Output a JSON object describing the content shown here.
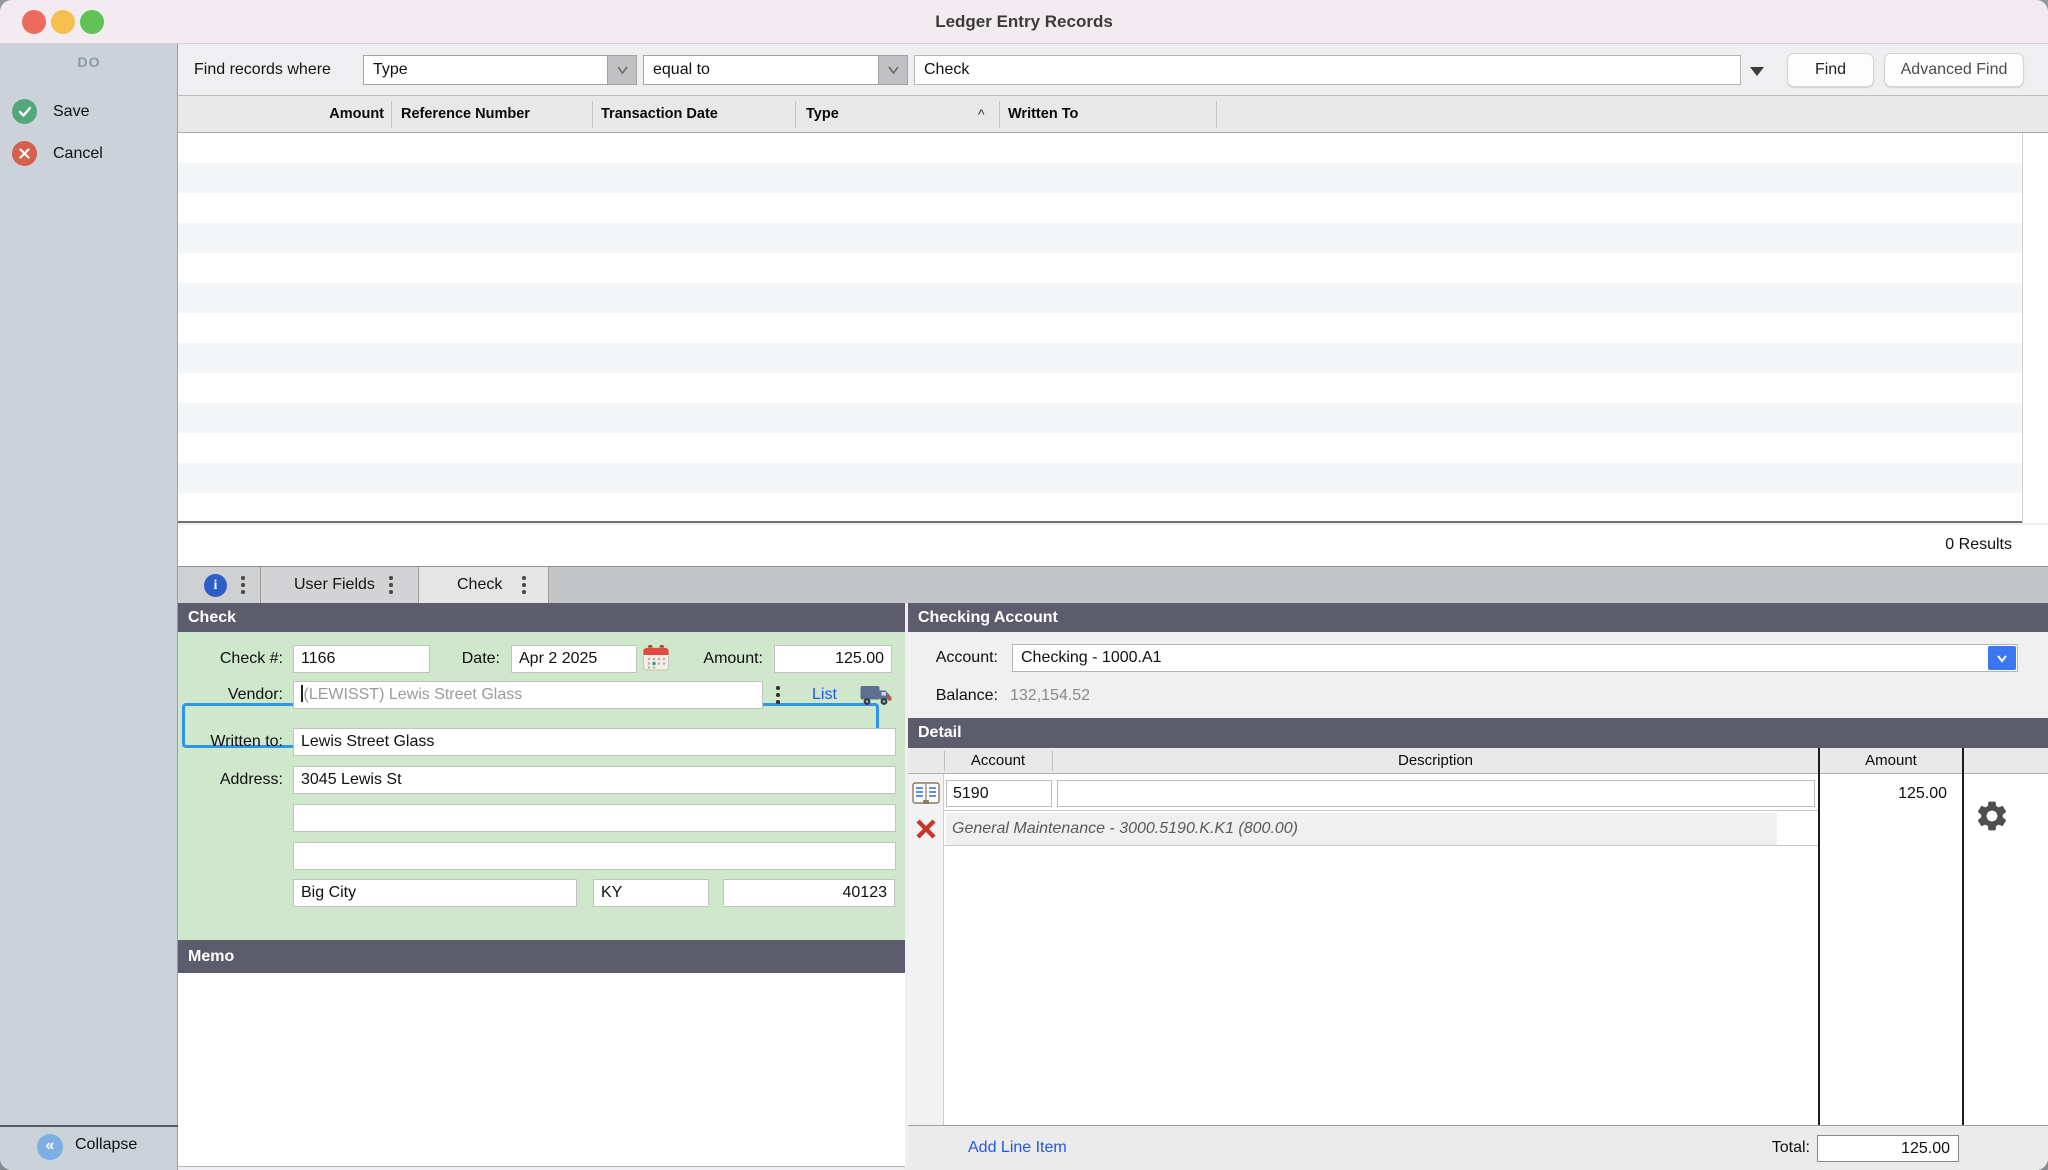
{
  "window": {
    "title": "Ledger Entry Records"
  },
  "sidebar": {
    "heading": "DO",
    "save_label": "Save",
    "cancel_label": "Cancel",
    "collapse_label": "Collapse",
    "collapse_glyph": "«"
  },
  "toolbar": {
    "find_where_label": "Find records where",
    "field_select_value": "Type",
    "operator_select_value": "equal to",
    "search_value": "Check",
    "find_label": "Find",
    "advanced_find_label": "Advanced Find"
  },
  "results_table": {
    "columns": {
      "c1": "Amount",
      "c2": "Reference Number",
      "c3": "Transaction Date",
      "c4": "Type",
      "c5": "Written To"
    },
    "sort_indicator": "^",
    "status": "0 Results",
    "rows": []
  },
  "tabs": {
    "info_glyph": "i",
    "user_fields_label": "User Fields",
    "check_label": "Check"
  },
  "check_panel": {
    "title": "Check",
    "check_number_label": "Check #:",
    "check_number": "1166",
    "date_label": "Date:",
    "date": "Apr 2 2025",
    "amount_label": "Amount:",
    "amount": "125.00",
    "vendor_label": "Vendor:",
    "vendor": "(LEWISST) Lewis Street Glass",
    "list_label": "List",
    "written_to_label": "Written to:",
    "written_to": "Lewis Street Glass",
    "address_label": "Address:",
    "address_line1": "3045 Lewis St",
    "address_line2": "",
    "address_line3": "",
    "city": "Big City",
    "state": "KY",
    "zip": "40123"
  },
  "memo_panel": {
    "title": "Memo",
    "content": ""
  },
  "account_panel": {
    "title": "Checking Account",
    "account_label": "Account:",
    "account_value": "Checking - 1000.A1",
    "balance_label": "Balance:",
    "balance_value": "132,154.52"
  },
  "detail_panel": {
    "title": "Detail",
    "columns": {
      "account": "Account",
      "description": "Description",
      "amount": "Amount"
    },
    "line_items": [
      {
        "account": "5190",
        "description": "",
        "amount": "125.00",
        "account_detail": "General Maintenance - 3000.5190.K.K1 (800.00)"
      }
    ],
    "add_line_label": "Add Line Item",
    "total_label": "Total:",
    "total": "125.00"
  },
  "colors": {
    "panel_header": "#5c5c6d",
    "check_panel_green": "#cfe8cc",
    "vendor_highlight_blue": "#2e95e8",
    "link_blue": "#2456e6",
    "account_dropdown_blue": "#3b77f2",
    "sidebar_bg": "#cbd2da",
    "save_green": "#53a87b",
    "cancel_red": "#d4604d",
    "delete_x_red": "#c9342b"
  }
}
